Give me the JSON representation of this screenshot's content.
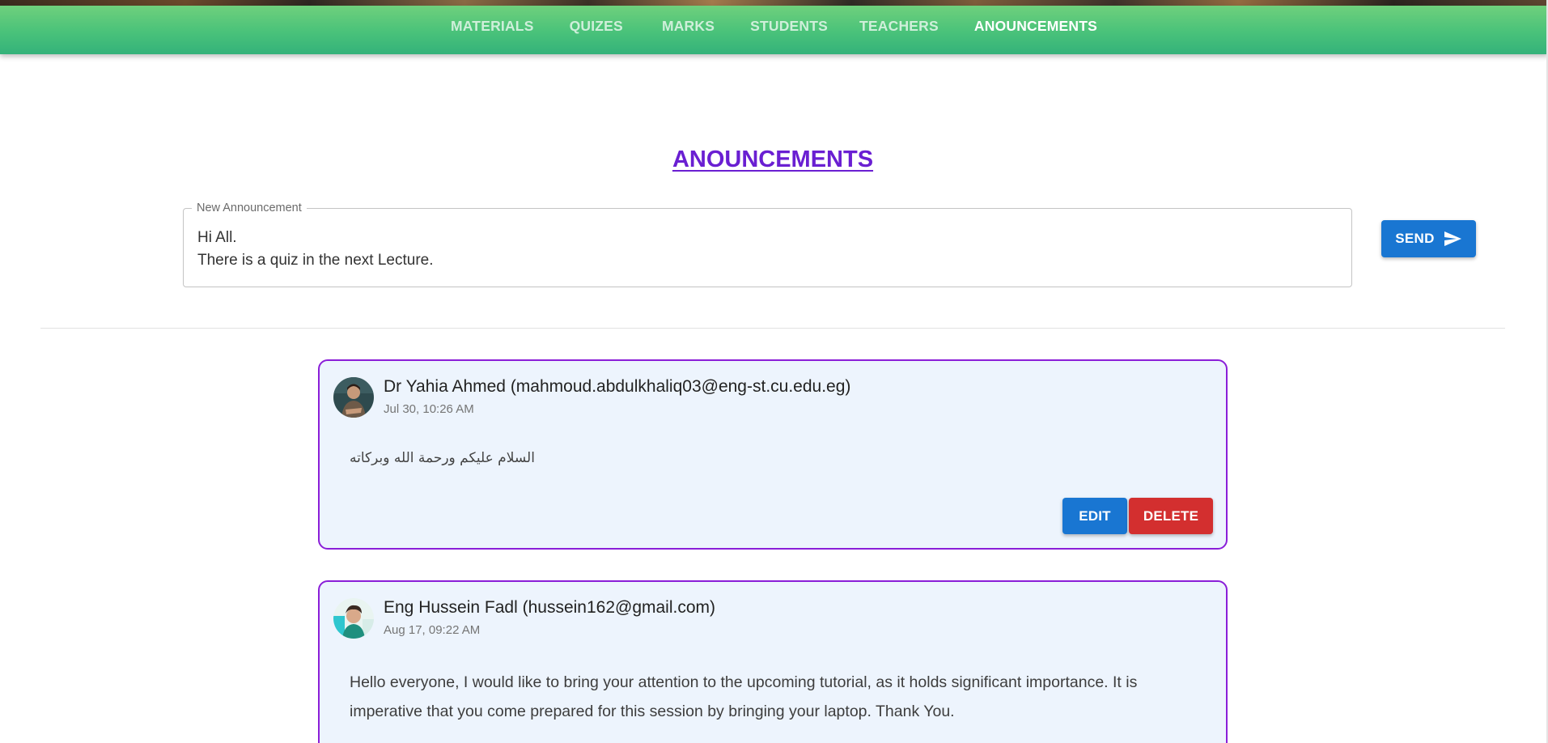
{
  "nav": {
    "items": [
      {
        "label": "MATERIALS"
      },
      {
        "label": "QUIZES"
      },
      {
        "label": "MARKS"
      },
      {
        "label": "STUDENTS"
      },
      {
        "label": "TEACHERS"
      },
      {
        "label": "ANOUNCEMENTS"
      }
    ],
    "active": "ANOUNCEMENTS"
  },
  "page": {
    "title": "ANOUNCEMENTS"
  },
  "composer": {
    "label": "New Announcement",
    "value": "Hi All.\nThere is a quiz in the next Lecture.",
    "send_label": "SEND",
    "send_icon": "send-icon"
  },
  "announcements": [
    {
      "author": "Dr Yahia Ahmed (mahmoud.abdulkhaliq03@eng-st.cu.edu.eg)",
      "date": "Jul 30, 10:26 AM",
      "message": "السلام عليكم ورحمة الله وبركاته",
      "edit_label": "EDIT",
      "delete_label": "DELETE"
    },
    {
      "author": "Eng Hussein Fadl (hussein162@gmail.com)",
      "date": "Aug 17, 09:22 AM",
      "message": "Hello everyone, I would like to bring your attention to the upcoming tutorial, as it holds significant importance. It is imperative that you come prepared for this session by bringing your laptop. Thank You."
    }
  ],
  "colors": {
    "nav_green": "#49c27a",
    "title_purple": "#6a1fd2",
    "card_border": "#8a1ed8",
    "card_bg": "#edf4fd",
    "primary_blue": "#1976d2",
    "danger_red": "#d32f2f"
  }
}
